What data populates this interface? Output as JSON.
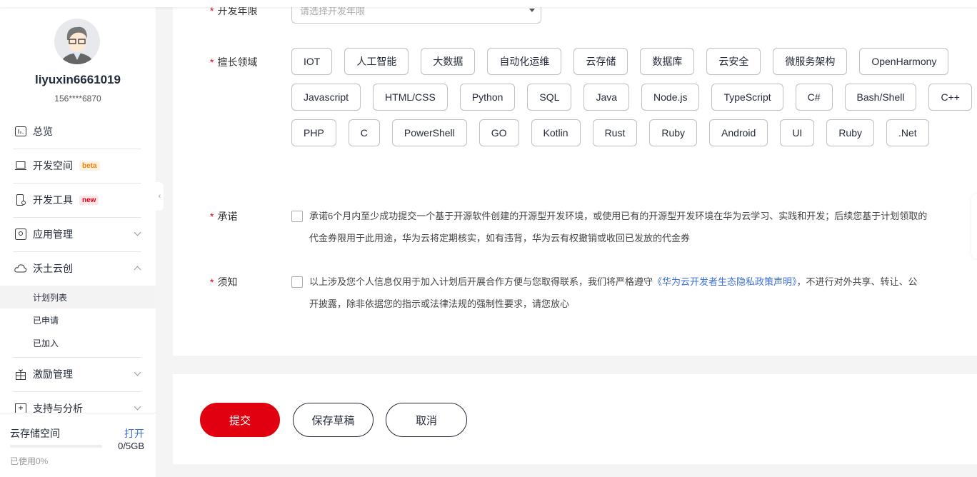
{
  "user": {
    "name": "liyuxin6661019",
    "phone": "156****6870"
  },
  "nav": [
    {
      "label": "总览",
      "icon": "chart-icon"
    },
    {
      "label": "开发空间",
      "icon": "laptop-code-icon",
      "badge": "beta"
    },
    {
      "label": "开发工具",
      "icon": "phone-tool-icon",
      "badge": "new"
    },
    {
      "label": "应用管理",
      "icon": "app-icon",
      "chevron": "down"
    },
    {
      "label": "沃土云创",
      "icon": "cloud-icon",
      "chevron": "up",
      "children": [
        "计划列表",
        "已申请",
        "已加入"
      ],
      "active_child": "计划列表"
    },
    {
      "label": "激励管理",
      "icon": "gift-icon",
      "chevron": "down"
    },
    {
      "label": "支持与分析",
      "icon": "support-icon",
      "chevron": "down"
    }
  ],
  "storage": {
    "title": "云存储空间",
    "action": "打开",
    "quota": "0/5GB",
    "used": "已使用0%",
    "used_percent": 0
  },
  "form": {
    "years": {
      "label": "开发年限",
      "placeholder": "请选择开发年限"
    },
    "domain": {
      "label": "擅长领域",
      "tags": [
        "IOT",
        "人工智能",
        "大数据",
        "自动化运维",
        "云存储",
        "数据库",
        "云安全",
        "微服务架构",
        "OpenHarmony",
        "Javascript",
        "HTML/CSS",
        "Python",
        "SQL",
        "Java",
        "Node.js",
        "TypeScript",
        "C#",
        "Bash/Shell",
        "C++",
        "PHP",
        "C",
        "PowerShell",
        "GO",
        "Kotlin",
        "Rust",
        "Ruby",
        "Android",
        "UI",
        "Ruby",
        ".Net"
      ]
    },
    "promise": {
      "label": "承诺",
      "line1": "承诺6个月内至少成功提交一个基于开源软件创建的开源型开发环境，或使用已有的开源型开发环境在华为云学习、实践和开发；后续您基于计划领取的",
      "line2": "代金券限用于此用途，华为云将定期核实，如有违背，华为云有权撤销或收回已发放的代金券",
      "checked": false
    },
    "notice": {
      "label": "须知",
      "before": "以上涉及您个人信息仅用于加入计划后开展合作方便与您取得联系，我们将严格遵守",
      "link": "《华为云开发者生态隐私政策声明》",
      "after": "，不进行对外共享、转让、公",
      "line2": "开披露，除非依据您的指示或法律法规的强制性要求，请您放心",
      "checked": false
    }
  },
  "actions": {
    "submit": "提交",
    "draft": "保存草稿",
    "cancel": "取消"
  },
  "colors": {
    "primary": "#e0000f",
    "link": "#3b6fd9",
    "beta": "#f08000",
    "new": "#e0001a"
  }
}
